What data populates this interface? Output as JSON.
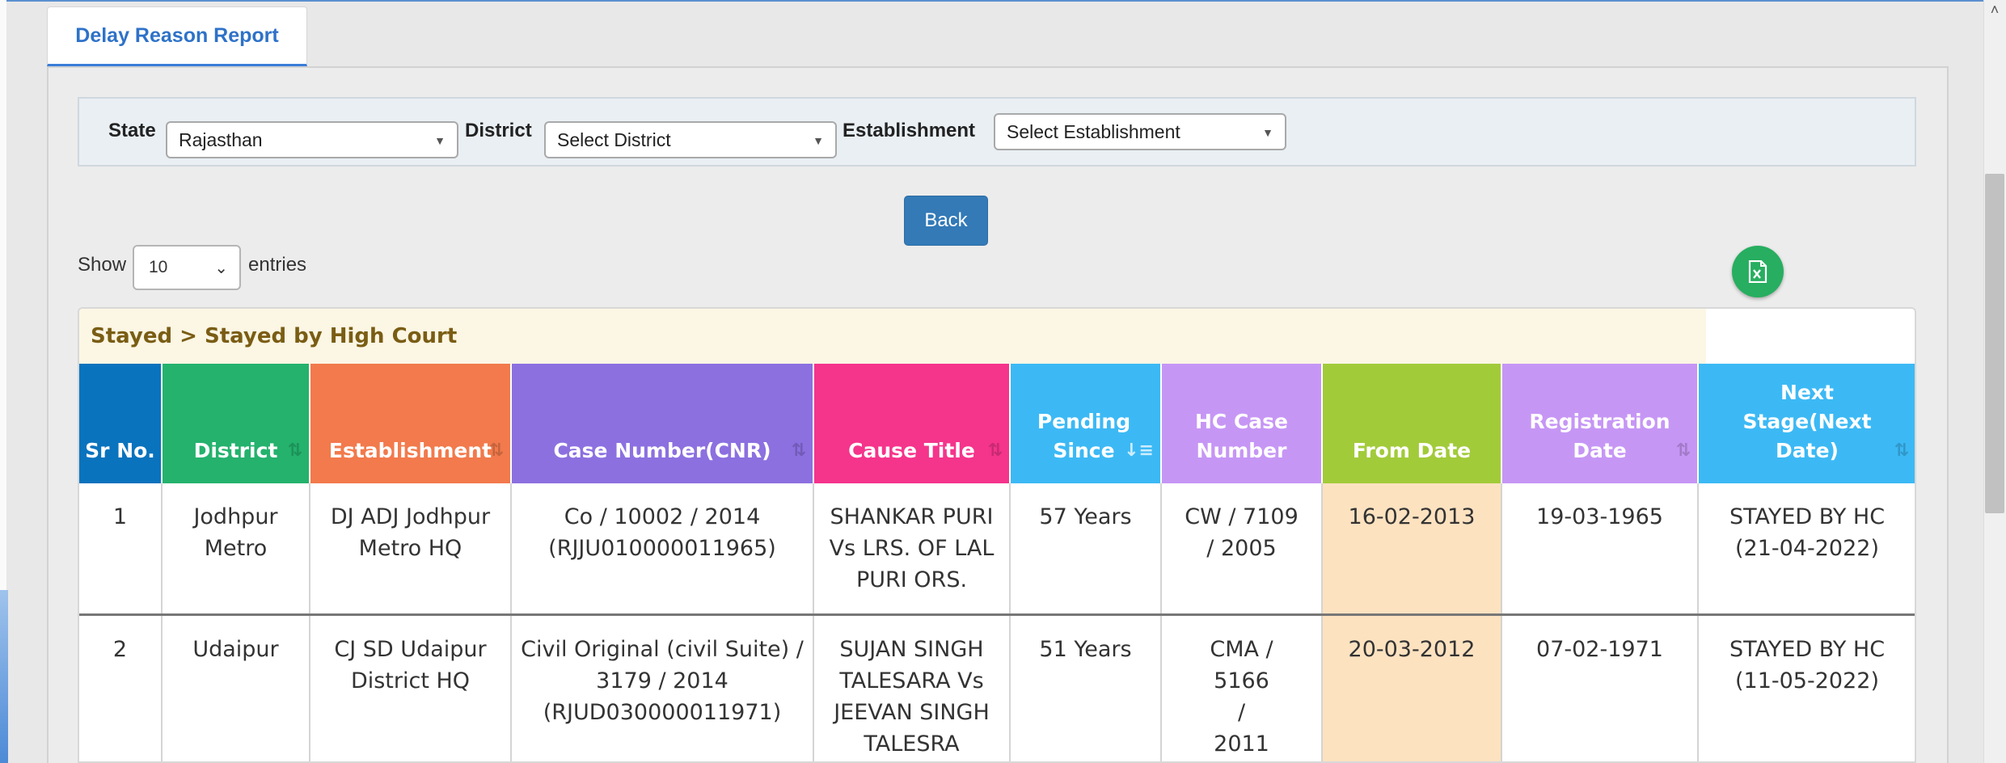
{
  "tab": {
    "label": "Delay Reason Report"
  },
  "filters": {
    "state": {
      "label": "State",
      "value": "Rajasthan"
    },
    "district": {
      "label": "District",
      "value": "Select District"
    },
    "establishment": {
      "label": "Establishment",
      "value": "Select Establishment"
    }
  },
  "back_button": "Back",
  "entries": {
    "show": "Show",
    "value": "10",
    "suffix": "entries"
  },
  "excel_icon": "excel-export-icon",
  "table": {
    "caption": "Stayed > Stayed by High Court",
    "headers": [
      {
        "label": "Sr No.",
        "color": "#0a73be"
      },
      {
        "label": "District",
        "color": "#24b26d"
      },
      {
        "label": "Establishment",
        "color": "#f27a4c"
      },
      {
        "label": "Case Number(CNR)",
        "color": "#8c70e0"
      },
      {
        "label": "Cause Title",
        "color": "#f5348c"
      },
      {
        "label": "Pending Since",
        "color": "#3cb9f5"
      },
      {
        "label": "HC Case Number",
        "color": "#c696f5"
      },
      {
        "label": "From Date",
        "color": "#a2cb3a"
      },
      {
        "label": "Registration Date",
        "color": "#c696f5"
      },
      {
        "label": "Next Stage(Next Date)",
        "color": "#3cb9f5"
      }
    ],
    "rows": [
      {
        "sr": "1",
        "district": "Jodhpur Metro",
        "establishment": "DJ ADJ Jodhpur Metro HQ",
        "case_number": "Co / 10002 / 2014 (RJJU010000011965)",
        "cause_title": "SHANKAR PURI Vs LRS. OF LAL PURI ORS.",
        "pending_since": "57 Years",
        "hc_case_number": "CW / 7109 / 2005",
        "from_date": "16-02-2013",
        "registration_date": "19-03-1965",
        "next_stage": "STAYED BY HC (21-04-2022)"
      },
      {
        "sr": "2",
        "district": "Udaipur",
        "establishment": "CJ SD Udaipur District HQ",
        "case_number": "Civil Original (civil Suite) / 3179 / 2014 (RJUD030000011971)",
        "cause_title": "SUJAN SINGH TALESARA Vs JEEVAN SINGH TALESRA",
        "pending_since": "51 Years",
        "hc_case_number": "CMA / 5166 / 2011",
        "from_date": "20-03-2012",
        "registration_date": "07-02-1971",
        "next_stage": "STAYED BY HC (11-05-2022)"
      }
    ]
  }
}
